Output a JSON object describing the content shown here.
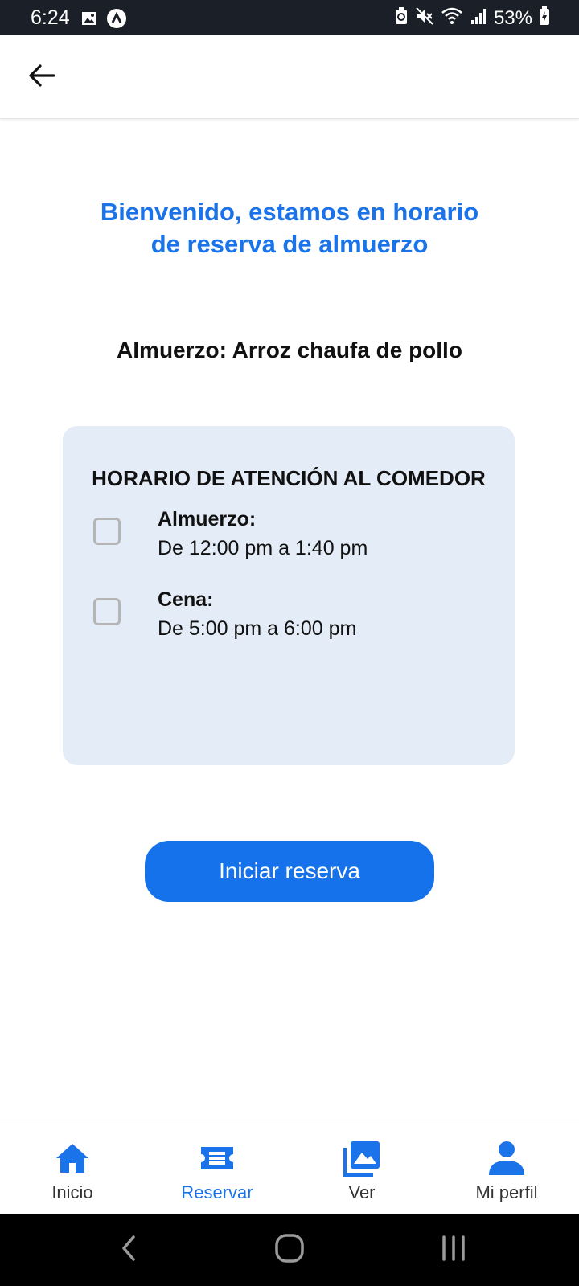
{
  "status_bar": {
    "time": "6:24",
    "battery_percent": "53%",
    "left_icons": [
      "gallery-icon",
      "app-notification-icon"
    ],
    "right_icons": [
      "battery-saver-icon",
      "mute-icon",
      "wifi-icon",
      "signal-icon",
      "battery-charging-icon"
    ]
  },
  "app_bar": {
    "back_icon": "arrow-left-icon"
  },
  "main": {
    "welcome_line1": "Bienvenido, estamos en horario",
    "welcome_line2": "de reserva de almuerzo",
    "menu_text": "Almuerzo: Arroz chaufa de pollo",
    "card": {
      "title": "HORARIO DE ATENCIÓN AL COMEDOR",
      "options": [
        {
          "name": "Almuerzo:",
          "time": "De 12:00 pm a 1:40 pm",
          "checked": false
        },
        {
          "name": "Cena:",
          "time": "De 5:00 pm a 6:00 pm",
          "checked": false
        }
      ]
    },
    "start_button": "Iniciar reserva"
  },
  "bottom_nav": {
    "items": [
      {
        "label": "Inicio",
        "icon": "home-icon",
        "active": false
      },
      {
        "label": "Reservar",
        "icon": "ticket-icon",
        "active": true
      },
      {
        "label": "Ver",
        "icon": "photo-library-icon",
        "active": false
      },
      {
        "label": "Mi perfil",
        "icon": "person-icon",
        "active": false
      }
    ]
  },
  "colors": {
    "accent": "#1a73e8",
    "button": "#1672ea",
    "card_bg": "#e4ecf7",
    "status_bar_bg": "#1b1f27"
  }
}
